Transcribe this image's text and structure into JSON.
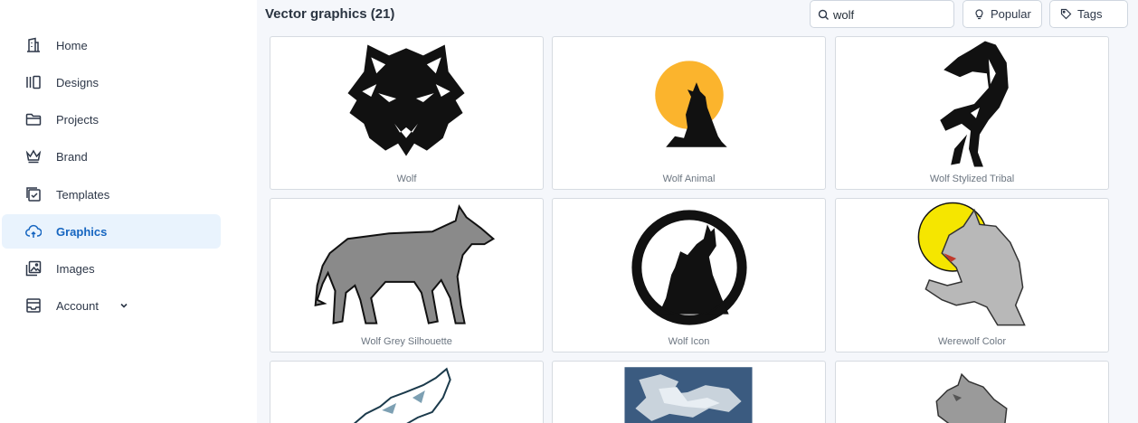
{
  "sidebar": {
    "items": [
      {
        "label": "Home",
        "icon": "building-icon"
      },
      {
        "label": "Designs",
        "icon": "designs-icon"
      },
      {
        "label": "Projects",
        "icon": "folder-icon"
      },
      {
        "label": "Brand",
        "icon": "crown-icon"
      },
      {
        "label": "Templates",
        "icon": "templates-icon"
      },
      {
        "label": "Graphics",
        "icon": "cloud-icon",
        "active": true
      },
      {
        "label": "Images",
        "icon": "images-icon"
      },
      {
        "label": "Account",
        "icon": "inbox-icon",
        "has_dropdown": true
      }
    ]
  },
  "header": {
    "title": "Vector graphics (21)",
    "search_value": "wolf",
    "popular_label": "Popular",
    "tags_label": "Tags"
  },
  "grid": {
    "cards": [
      {
        "caption": "Wolf"
      },
      {
        "caption": "Wolf Animal"
      },
      {
        "caption": "Wolf Stylized Tribal"
      },
      {
        "caption": "Wolf Grey Silhouette"
      },
      {
        "caption": "Wolf Icon"
      },
      {
        "caption": "Werewolf Color"
      },
      {
        "caption": ""
      },
      {
        "caption": ""
      },
      {
        "caption": ""
      }
    ]
  },
  "colors": {
    "accent": "#1565c0",
    "active_bg": "#e9f3fd",
    "moon": "#fbb42d",
    "werewolf_moon": "#f5e600",
    "wolf_grey": "#8a8a8a"
  }
}
